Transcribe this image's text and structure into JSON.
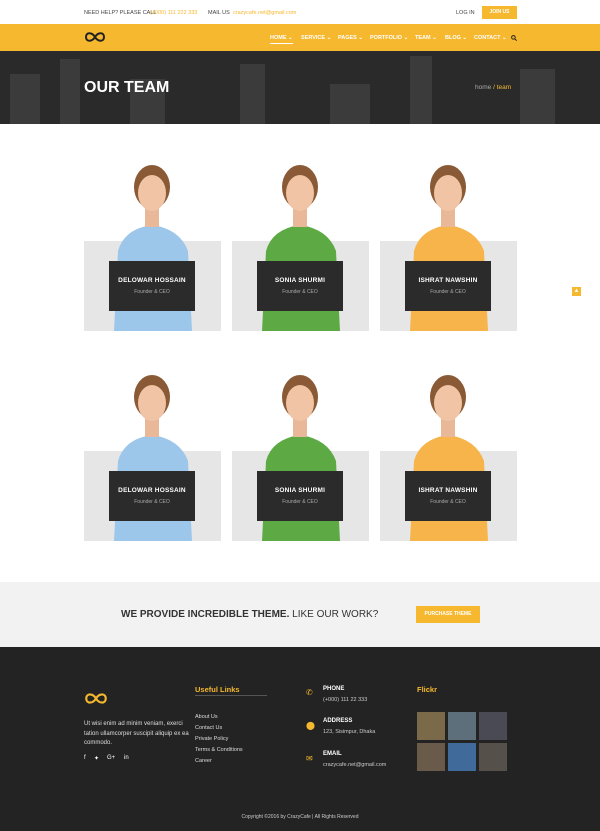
{
  "topbar": {
    "help_label": "NEED HELP? PLEASE CALL",
    "phone": "(+000) 111 222 333",
    "mail_label": "MAIL US",
    "email": "crazycafe.net@gmail.com",
    "login": "LOG IN",
    "join": "JOIN US"
  },
  "nav": {
    "items": [
      "HOME",
      "SERVICE",
      "PAGES",
      "PORTFOLIO",
      "TEAM",
      "BLOG",
      "CONTACT"
    ],
    "active": "HOME"
  },
  "hero": {
    "title": "OUR TEAM",
    "crumb_home": "home",
    "crumb_current": "/ team"
  },
  "team": [
    {
      "name": "DELOWAR HOSSAIN",
      "role": "Founder & CEO",
      "shirt": "#9cc7ea"
    },
    {
      "name": "SONIA SHURMI",
      "role": "Founder & CEO",
      "shirt": "#5daa45"
    },
    {
      "name": "ISHRAT NAWSHIN",
      "role": "Founder & CEO",
      "shirt": "#f7b44a"
    },
    {
      "name": "DELOWAR HOSSAIN",
      "role": "Founder & CEO",
      "shirt": "#9cc7ea"
    },
    {
      "name": "SONIA SHURMI",
      "role": "Founder & CEO",
      "shirt": "#5daa45"
    },
    {
      "name": "ISHRAT NAWSHIN",
      "role": "Founder & CEO",
      "shirt": "#f7b44a"
    }
  ],
  "cta": {
    "bold": "WE PROVIDE INCREDIBLE THEME.",
    "rest": "LIKE OUR WORK?",
    "button": "PURCHASE THEME"
  },
  "footer": {
    "about": "Ut wisi enim ad minim veniam, exerci tation ullamcorper suscipit aliquip ex ea commodo.",
    "social": [
      "f",
      "♥",
      "G+",
      "in"
    ],
    "links_title": "Useful Links",
    "links": [
      "About Us",
      "Contact Us",
      "Private Policy",
      "Terms & Conditions",
      "Career"
    ],
    "phone_label": "PHONE",
    "phone": "(+000) 111 22 333",
    "address_label": "ADDRESS",
    "address": "123, Sisimpur, Dhaka",
    "email_label": "EMAIL",
    "email": "crazycafe.net@gmail.com",
    "flickr_title": "Flickr",
    "copyright": "Copyright ©2016 by CrazyCafe   |   All Rights Reserved"
  },
  "colors": {
    "accent": "#f5b82e",
    "dark": "#232323"
  }
}
